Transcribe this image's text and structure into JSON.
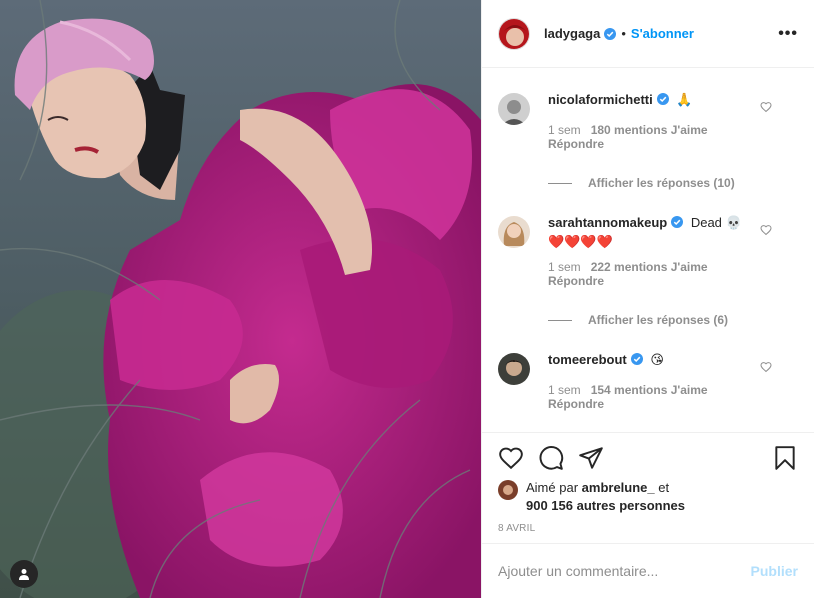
{
  "post_author": {
    "username": "ladygaga",
    "follow_label": "S'abonner",
    "separator": "•",
    "more_label": "•••"
  },
  "comments": [
    {
      "username": "nicolaformichetti",
      "text": "🙏",
      "time": "1 sem",
      "likes": "180 mentions J'aime",
      "reply_label": "Répondre",
      "view_replies": "Afficher les réponses (10)"
    },
    {
      "username": "sarahtannomakeup",
      "text": "Dead 💀",
      "text_line2": "❤️❤️❤️❤️",
      "time": "1 sem",
      "likes": "222 mentions J'aime",
      "reply_label": "Répondre",
      "view_replies": "Afficher les réponses (6)"
    },
    {
      "username": "tomeerebout",
      "text": "😘",
      "time": "1 sem",
      "likes": "154 mentions J'aime",
      "reply_label": "Répondre"
    }
  ],
  "likes": {
    "prefix": "Aimé par",
    "first_user": "ambrelune_",
    "connector": "et",
    "others": "900 156 autres personnes"
  },
  "date": "8 AVRIL",
  "add_comment": {
    "placeholder": "Ajouter un commentaire...",
    "publish_label": "Publier"
  },
  "colors": {
    "accent": "#0095f6",
    "verified": "#3897f0",
    "publish_disabled": "#b2dffc",
    "dress": "#b3207f"
  },
  "icons": {
    "like": "heart-icon",
    "comment": "comment-bubble-icon",
    "share": "paper-plane-icon",
    "save": "bookmark-icon",
    "tags": "user-tag-icon"
  }
}
